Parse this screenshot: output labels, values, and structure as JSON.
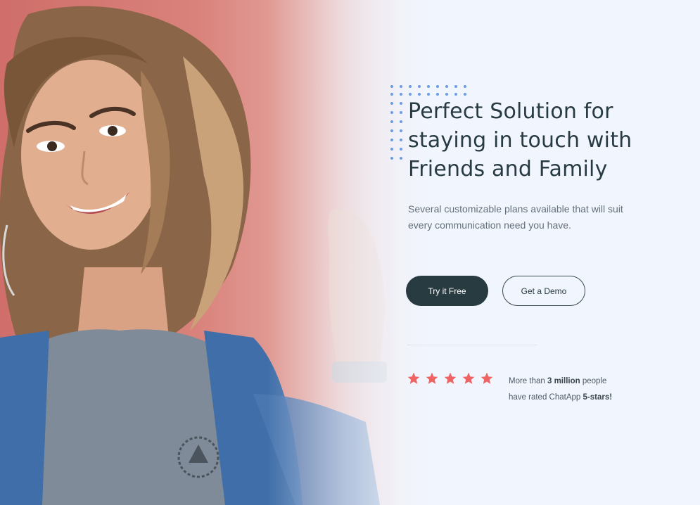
{
  "hero": {
    "title_line1": "Perfect Solution for",
    "title_line2": "staying in touch with",
    "title_line3": "Friends and Family",
    "subtitle_line1": "Several customizable plans available that will suit",
    "subtitle_line2": "every communication need you have."
  },
  "actions": {
    "primary_label": "Try it Free",
    "secondary_label": "Get a Demo"
  },
  "rating": {
    "stars": 5,
    "star_color": "#ef6363",
    "text_prefix": "More than",
    "highlight_count": "3 million",
    "text_middle": "people",
    "text_line2_prefix": "have rated ChatApp",
    "highlight_stars": "5-stars!"
  },
  "colors": {
    "background": "#f1f5fd",
    "dark_button": "#283b41",
    "heading": "#283a42",
    "dots": "#6c9be8"
  },
  "images": {
    "hero_photo": "smiling-woman-photo"
  }
}
